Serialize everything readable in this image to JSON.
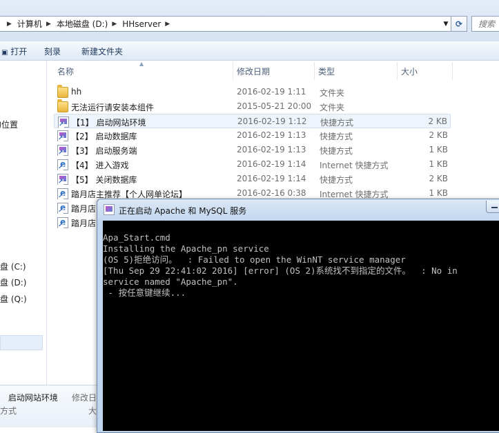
{
  "address": {
    "crumbs": [
      "计算机",
      "本地磁盘 (D:)",
      "HHserver"
    ],
    "search_placeholder": "搜索"
  },
  "toolbar": {
    "open_label": "打开",
    "burn_label": "刻录",
    "new_folder_label": "新建文件夹"
  },
  "nav": {
    "recent_places_fragment": "的位置",
    "drive_c_fragment": "盘 (C:)",
    "drive_d_fragment": "盘 (D:)",
    "drive_q_fragment": "盘 (Q:)"
  },
  "columns": {
    "name": "名称",
    "date": "修改日期",
    "type": "类型",
    "size": "大小"
  },
  "files": [
    {
      "name": "hh",
      "date": "2016-02-19 1:11",
      "type": "文件夹",
      "size": "",
      "icon": "folder-icon"
    },
    {
      "name": "无法运行请安装本组件",
      "date": "2015-05-21 20:00",
      "type": "文件夹",
      "size": "",
      "icon": "folder-icon"
    },
    {
      "name": "【1】 启动网站环境",
      "date": "2016-02-19 1:12",
      "type": "快捷方式",
      "size": "2 KB",
      "icon": "shortcut-icon"
    },
    {
      "name": "【2】 启动数据库",
      "date": "2016-02-19 1:13",
      "type": "快捷方式",
      "size": "2 KB",
      "icon": "shortcut-icon"
    },
    {
      "name": "【3】 启动服务端",
      "date": "2016-02-19 1:13",
      "type": "快捷方式",
      "size": "1 KB",
      "icon": "shortcut-icon"
    },
    {
      "name": "【4】 进入游戏",
      "date": "2016-02-19 1:14",
      "type": "Internet 快捷方式",
      "size": "1 KB",
      "icon": "internet-shortcut-icon"
    },
    {
      "name": "【5】 关闭数据库",
      "date": "2016-02-19 1:14",
      "type": "快捷方式",
      "size": "2 KB",
      "icon": "shortcut-icon"
    },
    {
      "name": "踏月店主推荐【个人网单论坛】",
      "date": "2016-02-16 0:38",
      "type": "Internet 快捷方式",
      "size": "1 KB",
      "icon": "internet-shortcut-icon"
    },
    {
      "name": "踏月店",
      "date": "",
      "type": "",
      "size": "",
      "icon": "internet-shortcut-icon"
    },
    {
      "name": "踏月店",
      "date": "",
      "type": "",
      "size": "",
      "icon": "internet-shortcut-icon"
    }
  ],
  "details": {
    "name_fragment": "】 启动网站环境",
    "modified_fragment": "修改日",
    "type_fragment": "方式",
    "size_fragment": "大"
  },
  "console_window": {
    "title": "正在启动 Apache 和 MySQL 服务",
    "lines": [
      "Apa_Start.cmd",
      "Installing the Apache_pn service",
      "(OS 5)拒绝访问。  : Failed to open the WinNT service manager",
      "[Thu Sep 29 22:41:02 2016] [error] (OS 2)系统找不到指定的文件。  : No in",
      "service named \"Apache_pn\".",
      " - 按任意键继续..."
    ]
  }
}
